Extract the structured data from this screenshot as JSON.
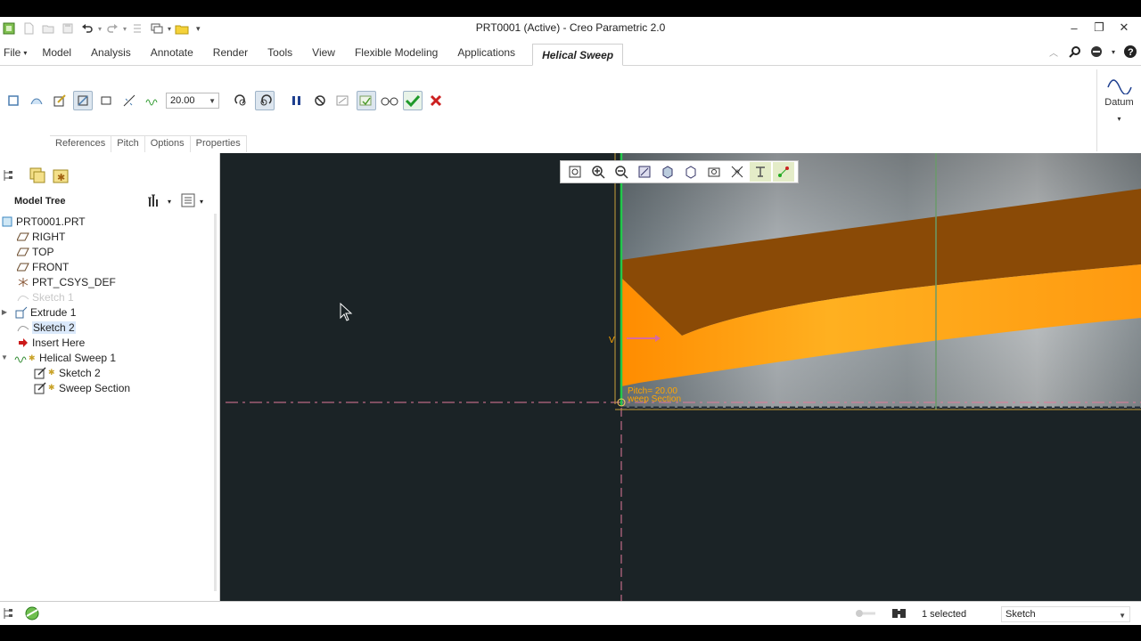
{
  "window": {
    "title": "PRT0001 (Active) - Creo Parametric 2.0"
  },
  "ribbon": {
    "tabs": [
      {
        "label": "File",
        "dropdown": "▾"
      },
      {
        "label": "Model"
      },
      {
        "label": "Analysis"
      },
      {
        "label": "Annotate"
      },
      {
        "label": "Render"
      },
      {
        "label": "Tools"
      },
      {
        "label": "View"
      },
      {
        "label": "Flexible Modeling"
      },
      {
        "label": "Applications"
      },
      {
        "label": "Helical Sweep"
      }
    ],
    "pitch_value": "20.00",
    "subtabs": [
      "References",
      "Pitch",
      "Options",
      "Properties"
    ],
    "datum_label": "Datum"
  },
  "model_tree": {
    "header": "Model Tree",
    "items": [
      {
        "label": "PRT0001.PRT",
        "icon": "part-icon"
      },
      {
        "label": "RIGHT",
        "icon": "datum-plane-icon"
      },
      {
        "label": "TOP",
        "icon": "datum-plane-icon"
      },
      {
        "label": "FRONT",
        "icon": "datum-plane-icon"
      },
      {
        "label": "PRT_CSYS_DEF",
        "icon": "csys-icon"
      },
      {
        "label": "Sketch 1",
        "icon": "sketch-icon"
      },
      {
        "label": "Extrude 1",
        "icon": "extrude-icon"
      },
      {
        "label": "Sketch 2",
        "icon": "sketch-icon"
      },
      {
        "label": "Insert Here",
        "icon": "insert-arrow-icon"
      },
      {
        "label": "Helical Sweep 1",
        "icon": "helical-sweep-icon"
      },
      {
        "label": "Sketch 2",
        "icon": "sketch-edit-icon"
      },
      {
        "label": "Sweep Section",
        "icon": "sketch-edit-icon"
      }
    ]
  },
  "canvas": {
    "pitch_dim_label": "Pitch= 20.00",
    "section_label": "weep Section",
    "v_label": "V",
    "colors": {
      "background": "#1b2326",
      "helix_light": "#ff9a10",
      "helix_dark": "#8a4a06",
      "cylinder": "#9ea4a8",
      "centerline": "#e07a9a"
    }
  },
  "status": {
    "selected_text": "1 selected",
    "filter_value": "Sketch"
  }
}
